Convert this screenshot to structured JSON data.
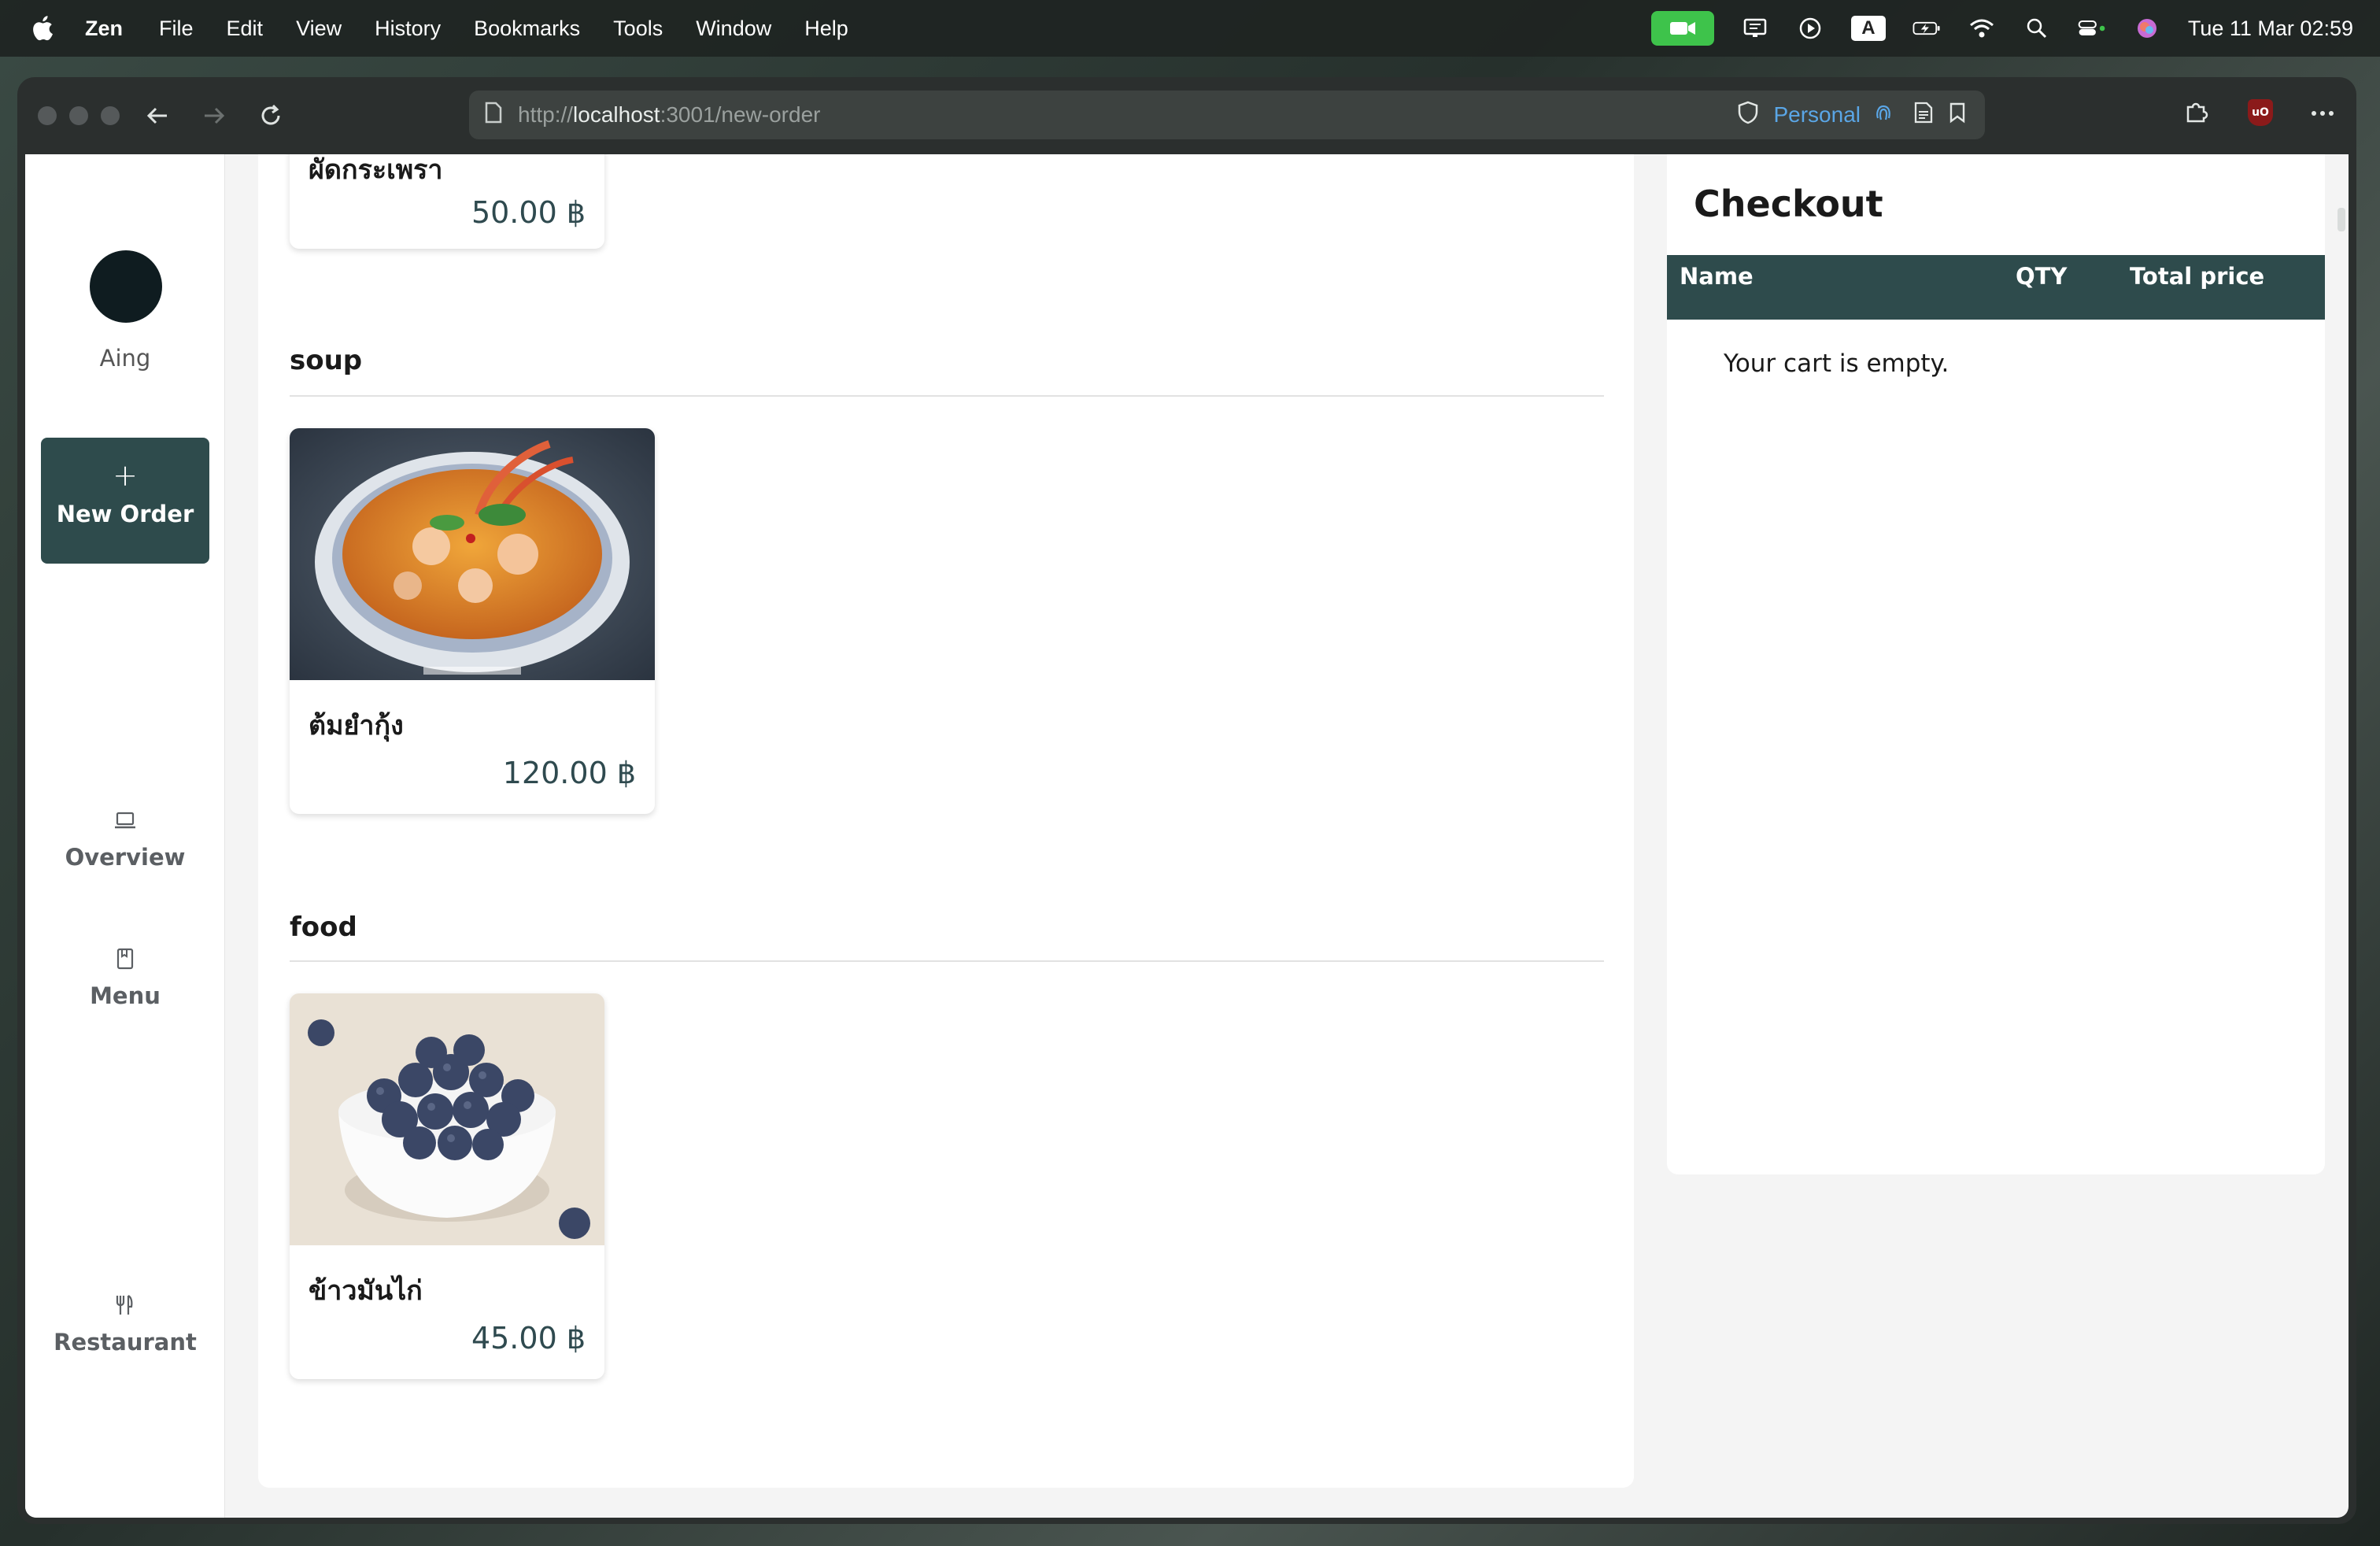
{
  "menubar": {
    "app_name": "Zen",
    "items": [
      "File",
      "Edit",
      "View",
      "History",
      "Bookmarks",
      "Tools",
      "Window",
      "Help"
    ],
    "clock": "Tue 11 Mar  02:59"
  },
  "browser": {
    "url_scheme": "http://",
    "url_host": "localhost",
    "url_rest": ":3001/new-order",
    "profile": "Personal"
  },
  "sidebar": {
    "username": "Aing",
    "new_order_icon": "+",
    "new_order_label": "New Order",
    "links": [
      {
        "label": "Overview",
        "icon": "laptop-icon"
      },
      {
        "label": "Menu",
        "icon": "book-icon"
      },
      {
        "label": "Restaurant",
        "icon": "utensils-icon"
      }
    ]
  },
  "menu": {
    "top_card": {
      "name": "ผัดกระเพรา",
      "price": "50.00 ฿"
    },
    "sections": [
      {
        "title": "soup",
        "items": [
          {
            "name": "ต้มยำกุ้ง",
            "price": "120.00 ฿",
            "image": "tom-yum-soup-photo"
          }
        ]
      },
      {
        "title": "food",
        "items": [
          {
            "name": "ข้าวมันไก่",
            "price": "45.00 ฿",
            "image": "blueberries-bowl-photo"
          }
        ]
      }
    ]
  },
  "checkout": {
    "title": "Checkout",
    "columns": [
      "Name",
      "QTY",
      "Total price"
    ],
    "empty_message": "Your cart is empty."
  },
  "colors": {
    "primary": "#2e4b4c",
    "price": "#2f4a4f",
    "background": "#f4f4f4"
  }
}
